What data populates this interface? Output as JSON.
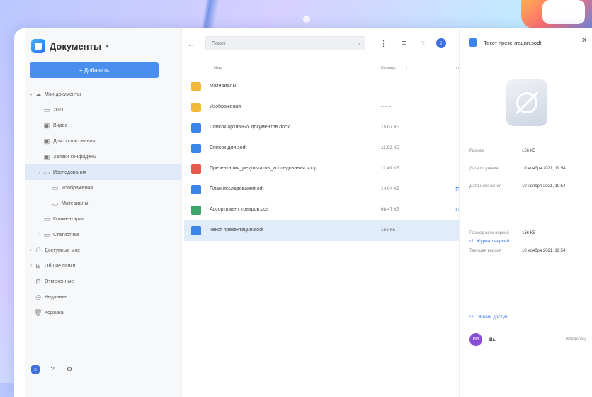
{
  "app": {
    "title": "Документы",
    "add_button": "+ Добавить"
  },
  "tree": [
    {
      "label": "Мои документы",
      "icon": "cloud-icon",
      "arrow": "▾",
      "indent": 0
    },
    {
      "label": "2021",
      "icon": "folder-icon",
      "arrow": "",
      "indent": 1
    },
    {
      "label": "Видео",
      "icon": "shared-folder-icon",
      "arrow": "",
      "indent": 1
    },
    {
      "label": "Для согласования",
      "icon": "shared-folder-icon",
      "arrow": "",
      "indent": 1
    },
    {
      "label": "Заявки конфиденц",
      "icon": "shared-folder-icon",
      "arrow": "",
      "indent": 1
    },
    {
      "label": "Исследования",
      "icon": "folder-icon",
      "arrow": "▾",
      "indent": 1,
      "active": true
    },
    {
      "label": "Изображения",
      "icon": "folder-icon",
      "arrow": "",
      "indent": 2
    },
    {
      "label": "Материалы",
      "icon": "folder-icon",
      "arrow": "",
      "indent": 2
    },
    {
      "label": "Комментарии",
      "icon": "folder-icon",
      "arrow": "",
      "indent": 1
    },
    {
      "label": "Статистика",
      "icon": "folder-icon",
      "arrow": "›",
      "indent": 1
    },
    {
      "label": "Доступные мне",
      "icon": "users-icon",
      "arrow": "›",
      "indent": 0
    },
    {
      "label": "Общие папки",
      "icon": "shared-icon",
      "arrow": "›",
      "indent": 0
    },
    {
      "label": "Отмеченные",
      "icon": "pin-icon",
      "arrow": "",
      "indent": 0
    },
    {
      "label": "Недавние",
      "icon": "clock-icon",
      "arrow": "",
      "indent": 0
    },
    {
      "label": "Корзина",
      "icon": "trash-icon",
      "arrow": "",
      "indent": 0
    }
  ],
  "search": {
    "placeholder": "Поиск"
  },
  "table": {
    "col_name": "Имя",
    "col_size": "Размер",
    "rows": [
      {
        "name": "Материалы",
        "size": "– – –",
        "type": "folder",
        "pinned": false
      },
      {
        "name": "Изображения",
        "size": "– – –",
        "type": "folder",
        "pinned": false
      },
      {
        "name": "Список архивных документов.docx",
        "size": "15.07 КБ",
        "type": "doc",
        "pinned": false
      },
      {
        "name": "Список для.sodt",
        "size": "11.03 КБ",
        "type": "doc",
        "pinned": false
      },
      {
        "name": "Презентация_результатов_исследования.sodp",
        "size": "11.49 КБ",
        "type": "ppt",
        "pinned": false
      },
      {
        "name": "План исследований.odt",
        "size": "14.04 КБ",
        "type": "pres",
        "pinned": true
      },
      {
        "name": "Ассортимент товаров.ods",
        "size": "68.47 КБ",
        "type": "sheet",
        "pinned": true
      },
      {
        "name": "Текст презентации.sodt",
        "size": "156 КБ",
        "type": "doc",
        "pinned": false,
        "selected": true
      }
    ]
  },
  "panel": {
    "title": "Текст презентации.sodt",
    "props": [
      {
        "k": "Размер",
        "v": "156 КБ"
      },
      {
        "k": "Дата создания",
        "v": "10 ноября 2021, 19:54"
      },
      {
        "k": "Дата изменения",
        "v": "10 ноября 2021, 19:54"
      }
    ],
    "history_link": "Журнал версий",
    "props2": [
      {
        "k": "Размер всех версий",
        "v": "156 КБ"
      },
      {
        "k": "Текущая версия",
        "v": "10 ноября 2021, 19:54"
      }
    ],
    "share_link": "Общий доступ",
    "user": {
      "initials": "ВИ",
      "name": "Вы",
      "role": "Владелец"
    }
  }
}
